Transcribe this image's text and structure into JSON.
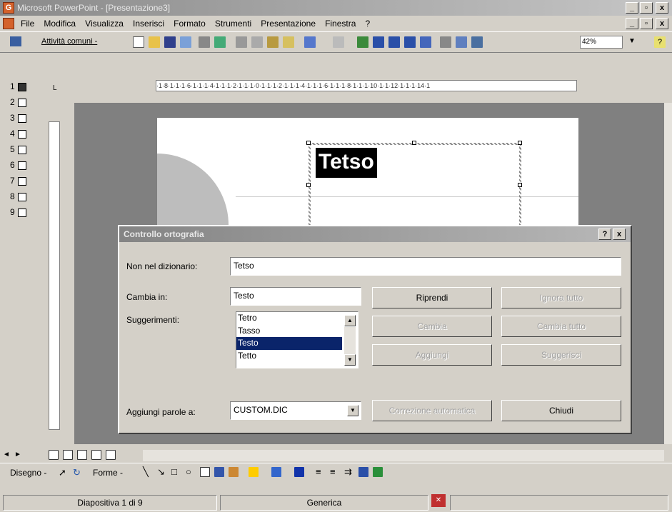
{
  "window": {
    "app_title": "Microsoft PowerPoint - [Presentazione3]",
    "min_label": "_",
    "max_label": "▫",
    "close_label": "x",
    "app_icon_letter": "G"
  },
  "menu": [
    "File",
    "Modifica",
    "Visualizza",
    "Inserisci",
    "Formato",
    "Strumenti",
    "Presentazione",
    "Finestra",
    "?"
  ],
  "toolbar": {
    "tasks_label": "Attività comuni -",
    "zoom": "42%",
    "help_label": "?"
  },
  "slides": [
    "1",
    "2",
    "3",
    "4",
    "5",
    "6",
    "7",
    "8",
    "9"
  ],
  "ruler_h_text": "·1·8·1·1·1·6·1·1·1·4·1·1·1·2·1·1·1·0·1·1·1·2·1·1·1·4·1·1·1·6·1·1·1·8·1·1·1·10·1·1·12·1·1·1·14·1",
  "slide": {
    "selected_text": "Tetso"
  },
  "dialog": {
    "title": "Controllo ortografia",
    "help_btn": "?",
    "close_btn": "x",
    "not_in_dict_label": "Non nel dizionario:",
    "not_in_dict_value": "Tetso",
    "change_to_label": "Cambia in:",
    "change_to_value": "Testo",
    "suggestions_label": "Suggerimenti:",
    "suggestions": [
      "Tetro",
      "Tasso",
      "Testo",
      "Tetto"
    ],
    "selected_suggestion": "Testo",
    "add_words_label": "Aggiungi parole a:",
    "add_words_value": "CUSTOM.DIC",
    "buttons": {
      "resume": "Riprendi",
      "ignore_all": "Ignora tutto",
      "change": "Cambia",
      "change_all": "Cambia tutto",
      "add": "Aggiungi",
      "suggest": "Suggerisci",
      "autocorrect": "Correzione automatica",
      "close": "Chiudi"
    }
  },
  "drawbar": {
    "draw_label": "Disegno -",
    "shapes_label": "Forme -"
  },
  "status": {
    "slide_info": "Diapositiva 1 di 9",
    "template": "Generica"
  },
  "colors": {
    "selection": "#0a246a",
    "app_icon": "#d4622c",
    "dialog_face": "#d4d0c8"
  }
}
